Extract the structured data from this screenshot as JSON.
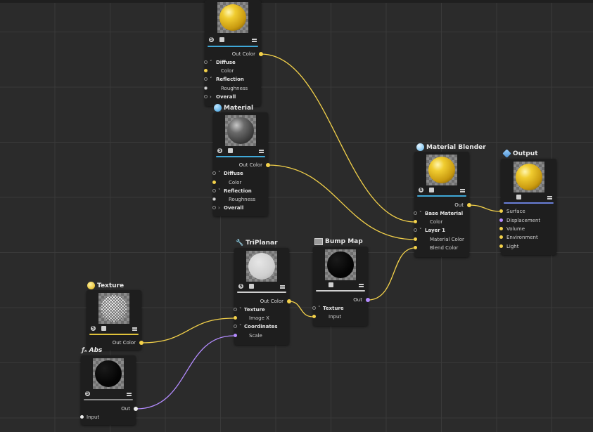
{
  "nodes": {
    "material_top": {
      "out_label": "Out Color",
      "rows": {
        "diffuse": "Diffuse",
        "color": "Color",
        "reflection": "Reflection",
        "roughness": "Roughness",
        "overall": "Overall"
      }
    },
    "material_mid": {
      "title": "Material",
      "out_label": "Out Color",
      "rows": {
        "diffuse": "Diffuse",
        "color": "Color",
        "reflection": "Reflection",
        "roughness": "Roughness",
        "overall": "Overall"
      }
    },
    "material_blender": {
      "title": "Material Blender",
      "out_label": "Out",
      "rows": {
        "base_material": "Base Material",
        "color": "Color",
        "layer1": "Layer 1",
        "material_color": "Material Color",
        "blend_color": "Blend Color"
      }
    },
    "output": {
      "title": "Output",
      "rows": {
        "surface": "Surface",
        "displacement": "Displacement",
        "volume": "Volume",
        "environment": "Environment",
        "light": "Light"
      }
    },
    "triplanar": {
      "title": "TriPlanar",
      "out_label": "Out Color",
      "rows": {
        "texture": "Texture",
        "image_x": "Image X",
        "coordinates": "Coordinates",
        "scale": "Scale"
      }
    },
    "bump_map": {
      "title": "Bump Map",
      "out_label": "Out",
      "rows": {
        "texture": "Texture",
        "input": "Input"
      }
    },
    "texture": {
      "title": "Texture",
      "out_label": "Out Color"
    },
    "abs": {
      "title": "Abs",
      "out_label": "Out",
      "rows": {
        "input": "Input"
      }
    }
  },
  "icons": {
    "material": "material-sphere-icon",
    "blender": "blender-icon",
    "output": "output-layers-icon",
    "triplanar": "wrench-icon",
    "bump_map": "image-icon",
    "texture": "texture-icon",
    "abs": "function-icon"
  },
  "colors": {
    "background": "#2b2b2b",
    "node_bg": "#1e1e1e",
    "wire_color": "#f3d14a",
    "wire_scalar": "#b48cff",
    "bar_material": "#3fa8d8",
    "bar_output": "#6a7fd8",
    "bar_texture": "#e0c23a",
    "bar_grey": "#cfcfcf"
  }
}
